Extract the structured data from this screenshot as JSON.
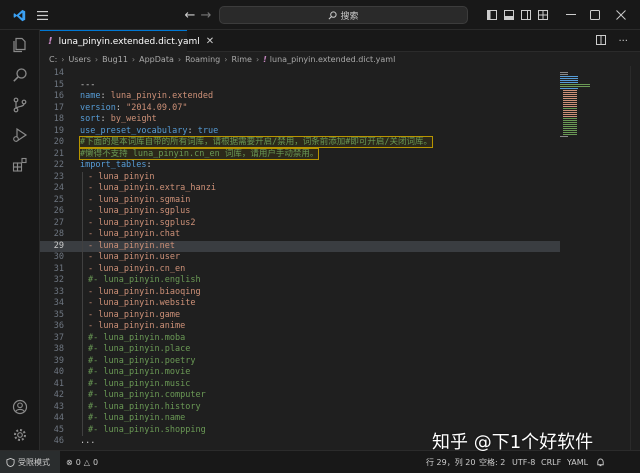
{
  "search": {
    "label": "搜索"
  },
  "tab": {
    "label": "luna_pinyin.extended.dict.yaml",
    "icon": "yaml-icon"
  },
  "breadcrumb": [
    "C:",
    "Users",
    "Bug11",
    "AppData",
    "Roaming",
    "Rime",
    "luna_pinyin.extended.dict.yaml"
  ],
  "editor": {
    "current_line": "29",
    "lines": [
      {
        "n": "14",
        "t": ""
      },
      {
        "n": "15",
        "t": "---"
      },
      {
        "n": "16",
        "k": "name",
        "v": "luna_pinyin.extended"
      },
      {
        "n": "17",
        "k": "version",
        "v": "\"2014.09.07\""
      },
      {
        "n": "18",
        "k": "sort",
        "v": "by_weight"
      },
      {
        "n": "19",
        "k": "use_preset_vocabulary",
        "v": "true"
      },
      {
        "n": "20",
        "c": "#下面的是本词库自带的所有词库，请根据需要开启/禁用，词条前添加#即可开启/关闭词库。"
      },
      {
        "n": "21",
        "c": "#懒得不支持 luna_pinyin.cn_en 词库，请用户手动禁用。"
      },
      {
        "n": "22",
        "k": "import_tables",
        "v": ""
      },
      {
        "n": "23",
        "i": "- luna_pinyin"
      },
      {
        "n": "24",
        "i": "- luna_pinyin.extra_hanzi"
      },
      {
        "n": "25",
        "i": "- luna_pinyin.sgmain"
      },
      {
        "n": "26",
        "i": "- luna_pinyin.sgplus"
      },
      {
        "n": "27",
        "i": "- luna_pinyin.sgplus2"
      },
      {
        "n": "28",
        "i": "- luna_pinyin.chat"
      },
      {
        "n": "29",
        "i": "- luna_pinyin.net"
      },
      {
        "n": "30",
        "i": "- luna_pinyin.user"
      },
      {
        "n": "31",
        "i": "- luna_pinyin.cn_en"
      },
      {
        "n": "32",
        "ic": "#- luna_pinyin.english"
      },
      {
        "n": "33",
        "i": "- luna_pinyin.biaoqing"
      },
      {
        "n": "34",
        "i": "- luna_pinyin.website"
      },
      {
        "n": "35",
        "i": "- luna_pinyin.game"
      },
      {
        "n": "36",
        "i": "- luna_pinyin.anime"
      },
      {
        "n": "37",
        "ic": "#- luna_pinyin.moba"
      },
      {
        "n": "38",
        "ic": "#- luna_pinyin.place"
      },
      {
        "n": "39",
        "ic": "#- luna_pinyin.poetry"
      },
      {
        "n": "40",
        "ic": "#- luna_pinyin.movie"
      },
      {
        "n": "41",
        "ic": "#- luna_pinyin.music"
      },
      {
        "n": "42",
        "ic": "#- luna_pinyin.computer"
      },
      {
        "n": "43",
        "ic": "#- luna_pinyin.history"
      },
      {
        "n": "44",
        "ic": "#- luna_pinyin.name"
      },
      {
        "n": "45",
        "ic": "#- luna_pinyin.shopping"
      },
      {
        "n": "46",
        "t": "..."
      }
    ]
  },
  "status": {
    "mode": "受限模式",
    "errors": "0",
    "warnings": "0",
    "position": "行 29，列 20",
    "spaces": "空格: 2",
    "encoding": "UTF-8",
    "eol": "CRLF",
    "language": "YAML"
  },
  "watermark": "知乎 @下1个好软件",
  "colors": {
    "accent": "#0078d4",
    "key": "#569cd6",
    "string": "#ce9178",
    "comment": "#6a9955"
  }
}
